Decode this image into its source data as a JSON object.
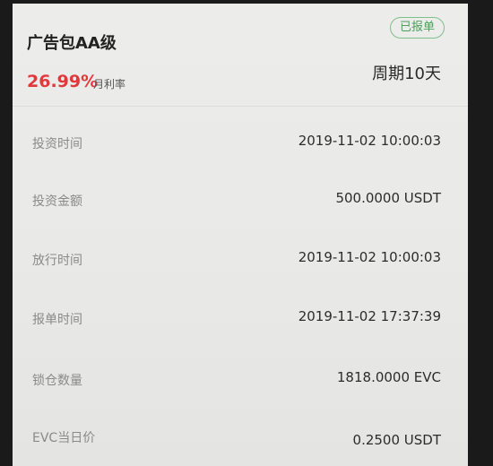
{
  "card": {
    "title": "广告包AA级",
    "status_badge": "已报单",
    "rate_value": "26.99%",
    "rate_label": "月利率",
    "cycle": "周期10天",
    "accent_color": "#e0393c",
    "badge_color": "#4f9d5c"
  },
  "details": [
    {
      "label": "投资时间",
      "value": "2019-11-02 10:00:03"
    },
    {
      "label": "投资金额",
      "value": "500.0000 USDT"
    },
    {
      "label": "放行时间",
      "value": "2019-11-02 10:00:03"
    },
    {
      "label": "报单时间",
      "value": "2019-11-02 17:37:39"
    },
    {
      "label": "锁仓数量",
      "value": "1818.0000 EVC"
    },
    {
      "label": "EVC当日价",
      "value": "0.2500 USDT"
    }
  ]
}
